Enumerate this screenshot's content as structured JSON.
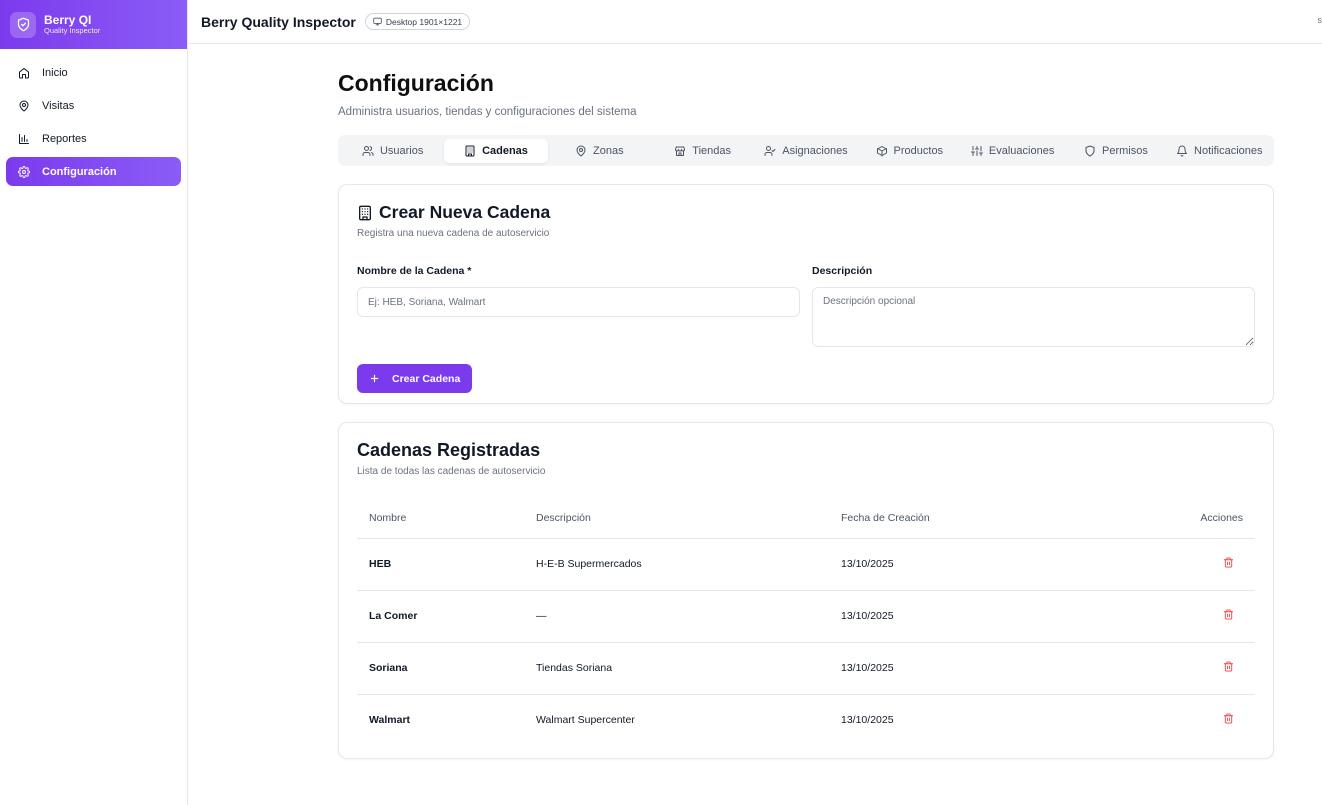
{
  "brand": {
    "name": "Berry QI",
    "subtitle": "Quality Inspector"
  },
  "sidebar": {
    "items": [
      {
        "label": "Inicio",
        "icon": "home-icon"
      },
      {
        "label": "Visitas",
        "icon": "map-pin-icon"
      },
      {
        "label": "Reportes",
        "icon": "bar-chart-icon"
      },
      {
        "label": "Configuración",
        "icon": "settings-icon",
        "active": true
      }
    ]
  },
  "topbar": {
    "title": "Berry Quality Inspector",
    "device": "Desktop 1901×1221",
    "right_text": "s"
  },
  "page": {
    "title": "Configuración",
    "subtitle": "Administra usuarios, tiendas y configuraciones del sistema"
  },
  "tabs": [
    {
      "label": "Usuarios",
      "icon": "users-icon"
    },
    {
      "label": "Cadenas",
      "icon": "building-icon",
      "active": true
    },
    {
      "label": "Zonas",
      "icon": "map-pin-icon"
    },
    {
      "label": "Tiendas",
      "icon": "store-icon"
    },
    {
      "label": "Asignaciones",
      "icon": "user-check-icon"
    },
    {
      "label": "Productos",
      "icon": "package-icon"
    },
    {
      "label": "Evaluaciones",
      "icon": "sliders-icon"
    },
    {
      "label": "Permisos",
      "icon": "shield-icon"
    },
    {
      "label": "Notificaciones",
      "icon": "bell-icon"
    }
  ],
  "create_form": {
    "title": "Crear Nueva Cadena",
    "subtitle": "Registra una nueva cadena de autoservicio",
    "name_label": "Nombre de la Cadena *",
    "name_placeholder": "Ej: HEB, Soriana, Walmart",
    "name_value": "",
    "description_label": "Descripción",
    "description_placeholder": "Descripción opcional",
    "description_value": "",
    "submit_label": "Crear Cadena"
  },
  "chains_list": {
    "title": "Cadenas Registradas",
    "subtitle": "Lista de todas las cadenas de autoservicio",
    "columns": [
      "Nombre",
      "Descripción",
      "Fecha de Creación",
      "Acciones"
    ],
    "rows": [
      {
        "name": "HEB",
        "description": "H-E-B Supermercados",
        "created": "13/10/2025"
      },
      {
        "name": "La Comer",
        "description": "—",
        "created": "13/10/2025"
      },
      {
        "name": "Soriana",
        "description": "Tiendas Soriana",
        "created": "13/10/2025"
      },
      {
        "name": "Walmart",
        "description": "Walmart Supercenter",
        "created": "13/10/2025"
      }
    ]
  },
  "colors": {
    "accent": "#7c3aed",
    "danger": "#ef4444"
  }
}
